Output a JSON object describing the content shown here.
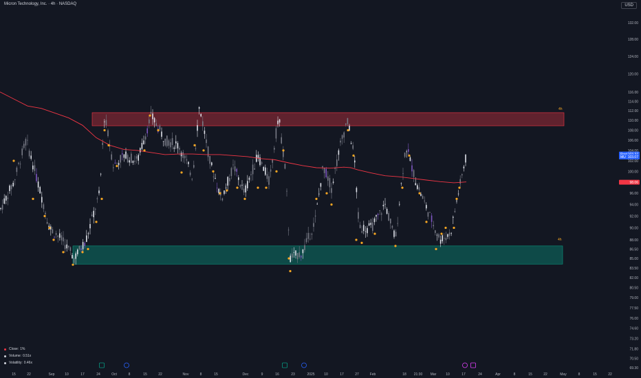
{
  "header": {
    "title": "Micron Technology, Inc. · 4h · NASDAQ",
    "currency": "USD"
  },
  "stats": [
    {
      "label": "Close",
      "value": "1%",
      "color": "#f23645"
    },
    {
      "label": "Volume",
      "value": "0.51x",
      "color": "#d1d4dc"
    },
    {
      "label": "Volatility",
      "value": "0.46x",
      "color": "#d1d4dc"
    }
  ],
  "price_tags": [
    {
      "name": "Post",
      "value": "103.37",
      "color": "#2962ff"
    },
    {
      "name": "MU",
      "value": "103.07",
      "color": "#2962ff"
    },
    {
      "name": "",
      "value": "98.06",
      "color": "#f23645"
    }
  ],
  "zone_labels": {
    "resistance": "4h",
    "support": "4h"
  },
  "chart_data": {
    "type": "candlestick",
    "symbol": "MU",
    "timeframe": "4h",
    "y_axis": {
      "scale": "log",
      "ticks": [
        "112.00",
        "108.00",
        "104.00",
        "100.00",
        "96.00",
        "92.00",
        "88.00",
        "84.00",
        "80.00",
        "76.00",
        "72.00",
        "69.30"
      ],
      "ylim": [
        69.3,
        134.6
      ],
      "tick_labels": [
        "132.00",
        "128.00",
        "124.00",
        "120.00",
        "116.00",
        "114.00",
        "112.00",
        "110.00",
        "108.00",
        "106.00",
        "104.00",
        "102.00",
        "100.00",
        "98.00",
        "96.00",
        "94.00",
        "92.00",
        "90.00",
        "88.00",
        "86.50",
        "85.00",
        "83.50",
        "82.00",
        "80.50",
        "79.00",
        "77.50",
        "76.00",
        "74.60",
        "73.20",
        "71.80",
        "70.50",
        "69.30"
      ]
    },
    "x_axis": {
      "tick_labels": [
        "15",
        "22",
        "Sep",
        "10",
        "17",
        "24",
        "Oct",
        "8",
        "15",
        "22",
        "Nov",
        "8",
        "15",
        "Dec",
        "9",
        "16",
        "23",
        "2025",
        "10",
        "17",
        "27",
        "Feb",
        "18",
        "21:30",
        "Mar",
        "10",
        "17",
        "24",
        "Apr",
        "8",
        "15",
        "22",
        "May",
        "8",
        "15",
        "22"
      ]
    },
    "zones": [
      {
        "type": "resistance",
        "low": 108.9,
        "high": 111.6,
        "color": "#f23645"
      },
      {
        "type": "support",
        "low": 84.1,
        "high": 87.0,
        "color": "#089981"
      }
    ],
    "moving_average_color": "#f23645",
    "marker_color": "#f5a623"
  }
}
